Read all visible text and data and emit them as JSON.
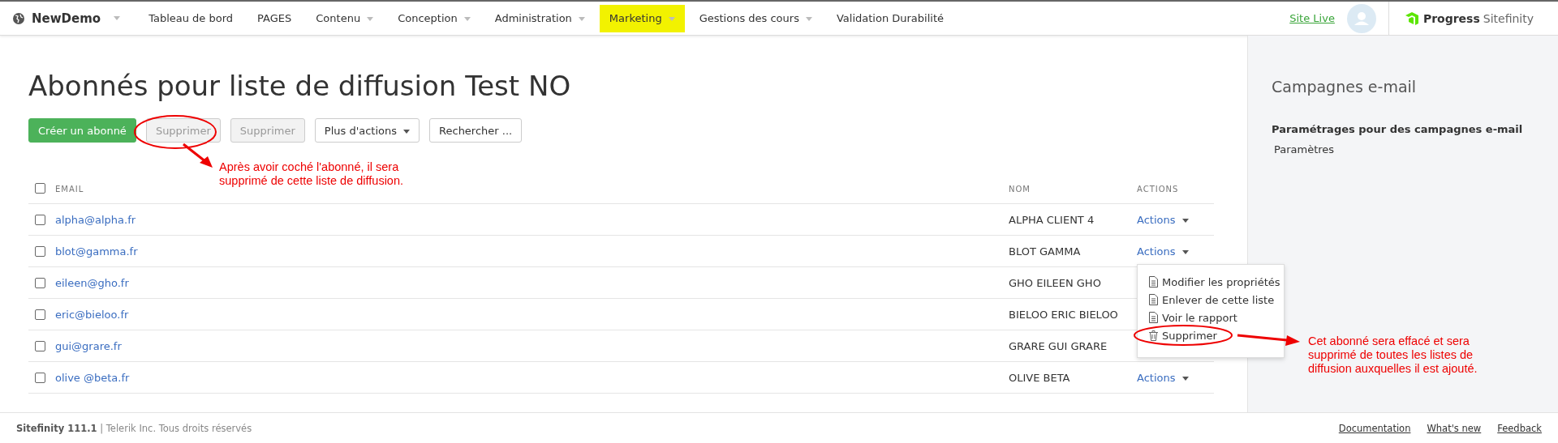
{
  "header": {
    "site": "NewDemo",
    "nav": [
      {
        "label": "Tableau de bord",
        "dropdown": false,
        "selected": false
      },
      {
        "label": "PAGES",
        "dropdown": false,
        "selected": false
      },
      {
        "label": "Contenu",
        "dropdown": true,
        "selected": false
      },
      {
        "label": "Conception",
        "dropdown": true,
        "selected": false
      },
      {
        "label": "Administration",
        "dropdown": true,
        "selected": false
      },
      {
        "label": "Marketing",
        "dropdown": true,
        "selected": true
      },
      {
        "label": "Gestions des cours",
        "dropdown": true,
        "selected": false
      },
      {
        "label": "Validation Durabilité",
        "dropdown": false,
        "selected": false
      }
    ],
    "site_live": "Site Live",
    "brand": {
      "name": "Progress",
      "product": "Sitefinity"
    }
  },
  "page": {
    "title": "Abonnés pour liste de diffusion Test NO",
    "toolbar": [
      {
        "label": "Créer un abonné",
        "kind": "primary",
        "disabled": false
      },
      {
        "label": "Supprimer",
        "kind": "plain",
        "disabled": true
      },
      {
        "label": "Supprimer",
        "kind": "plain",
        "disabled": true
      },
      {
        "label": "Plus d'actions",
        "kind": "dropdown",
        "disabled": false
      },
      {
        "label": "Rechercher ...",
        "kind": "plain",
        "disabled": false
      }
    ]
  },
  "table": {
    "columns": [
      "EMAIL",
      "NOM",
      "ACTIONS"
    ],
    "select_all_checked": false,
    "rows": [
      {
        "email": "alpha@alpha.fr",
        "name": "ALPHA CLIENT 4",
        "actions": "Actions",
        "checked": false
      },
      {
        "email": "blot@gamma.fr",
        "name": "BLOT GAMMA",
        "actions": "Actions",
        "checked": false
      },
      {
        "email": "eileen@gho.fr",
        "name": "GHO EILEEN GHO",
        "checked": false
      },
      {
        "email": "eric@bieloo.fr",
        "name": "BIELOO ERIC BIELOO",
        "checked": false
      },
      {
        "email": "gui@grare.fr",
        "name": "GRARE GUI GRARE",
        "checked": false
      },
      {
        "email": "olive @beta.fr",
        "name": "OLIVE BETA",
        "actions": "Actions",
        "checked": false
      }
    ]
  },
  "actions_menu": [
    {
      "label": "Modifier les propriétés",
      "kind": "document"
    },
    {
      "label": "Enlever de cette liste",
      "kind": "document"
    },
    {
      "label": "Voir le rapport",
      "kind": "document"
    },
    {
      "label": "Supprimer",
      "kind": "trash"
    }
  ],
  "annotations": [
    {
      "text": "Après avoir coché l'abonné, il sera supprimé de cette liste de diffusion."
    },
    {
      "text": "Cet abonné sera effacé et sera supprimé de toutes les listes de diffusion auxquelles il est ajouté."
    }
  ],
  "sidebar": {
    "title": "Campagnes e-mail",
    "section": "Paramétrages pour des campagnes e-mail",
    "link": "Paramètres"
  },
  "footer": {
    "version": "Sitefinity 111.1",
    "copyright": "| Telerik Inc. Tous droits réservés",
    "links": [
      "Documentation",
      "What's new",
      "Feedback"
    ]
  }
}
